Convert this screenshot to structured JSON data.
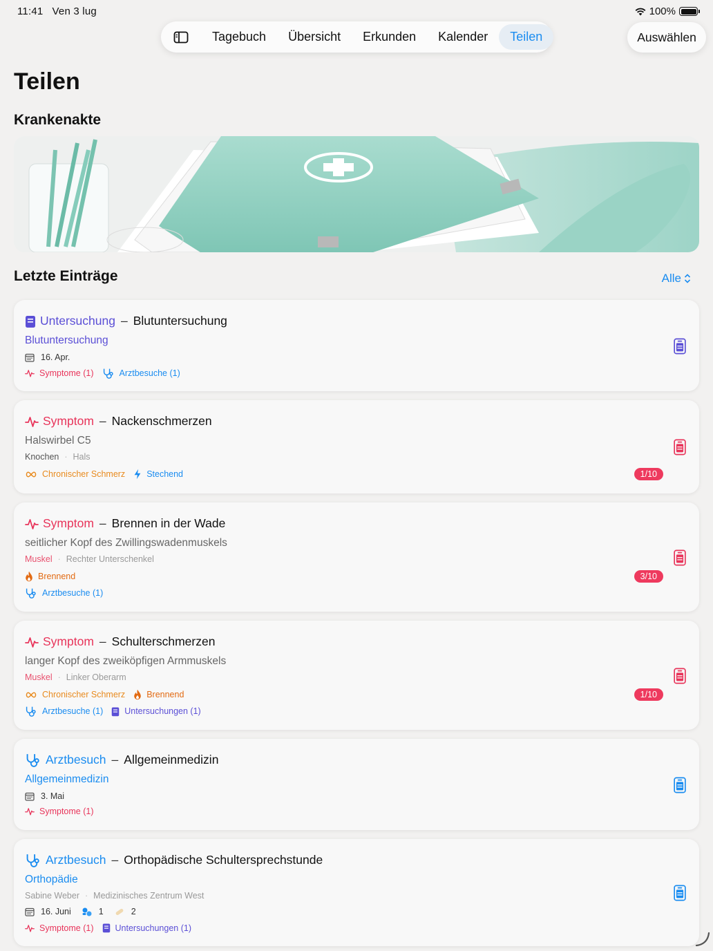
{
  "status": {
    "time": "11:41",
    "date": "Ven 3 lug",
    "battery": "100%"
  },
  "nav": {
    "tabs": [
      {
        "label": "Tagebuch"
      },
      {
        "label": "Übersicht"
      },
      {
        "label": "Erkunden"
      },
      {
        "label": "Kalender"
      },
      {
        "label": "Teilen",
        "active": true
      }
    ],
    "select_label": "Auswählen"
  },
  "page": {
    "title": "Teilen",
    "record_section": "Krankenakte",
    "recent_section": "Letzte Einträge",
    "filter_label": "Alle"
  },
  "colors": {
    "accent": "#1a8cf0",
    "symptom": "#e8345a",
    "exam": "#5b4fd6",
    "badge": "#ee3a5e",
    "chronic": "#e88a1e",
    "burning": "#e26a12"
  },
  "entries": [
    {
      "category": "Untersuchung",
      "title": "Blutuntersuchung",
      "icon": "clipboard-icon",
      "subtitle": "Blutuntersuchung",
      "date": "16. Apr.",
      "chips": [
        {
          "label": "Symptome (1)",
          "icon": "pulse-icon"
        },
        {
          "label": "Arztbesuche (1)",
          "icon": "stethoscope-icon"
        }
      ]
    },
    {
      "category": "Symptom",
      "title": "Nackenschmerzen",
      "icon": "pulse-icon",
      "subtitle": "Halswirbel C5",
      "meta": [
        "Knochen",
        "Hals"
      ],
      "chips": [
        {
          "label": "Chronischer Schmerz",
          "icon": "infinity-icon"
        },
        {
          "label": "Stechend",
          "icon": "bolt-icon"
        }
      ],
      "severity": "1/10"
    },
    {
      "category": "Symptom",
      "title": "Brennen in der Wade",
      "icon": "pulse-icon",
      "subtitle": "seitlicher Kopf des Zwillingswadenmuskels",
      "meta": [
        "Muskel",
        "Rechter Unterschenkel"
      ],
      "chips": [
        {
          "label": "Brennend",
          "icon": "flame-icon"
        }
      ],
      "chips2": [
        {
          "label": "Arztbesuche (1)",
          "icon": "stethoscope-icon"
        }
      ],
      "severity": "3/10"
    },
    {
      "category": "Symptom",
      "title": "Schulterschmerzen",
      "icon": "pulse-icon",
      "subtitle": "langer Kopf des zweiköpfigen Armmuskels",
      "meta": [
        "Muskel",
        "Linker Oberarm"
      ],
      "chips": [
        {
          "label": "Chronischer Schmerz",
          "icon": "infinity-icon"
        },
        {
          "label": "Brennend",
          "icon": "flame-icon"
        }
      ],
      "chips2": [
        {
          "label": "Arztbesuche (1)",
          "icon": "stethoscope-icon"
        },
        {
          "label": "Untersuchungen (1)",
          "icon": "clipboard-icon"
        }
      ],
      "severity": "1/10"
    },
    {
      "category": "Arztbesuch",
      "title": "Allgemeinmedizin",
      "icon": "stethoscope-icon",
      "subtitle": "Allgemeinmedizin",
      "date": "3. Mai",
      "chips": [
        {
          "label": "Symptome (1)",
          "icon": "pulse-icon"
        }
      ]
    },
    {
      "category": "Arztbesuch",
      "title": "Orthopädische Schultersprechstunde",
      "icon": "stethoscope-icon",
      "subtitle": "Orthopädie",
      "meta": [
        "Sabine Weber",
        "Medizinisches Zentrum West"
      ],
      "date": "16. Juni",
      "pills_count": "1",
      "bandage_count": "2",
      "chips": [
        {
          "label": "Symptome (1)",
          "icon": "pulse-icon"
        },
        {
          "label": "Untersuchungen (1)",
          "icon": "clipboard-icon"
        }
      ]
    }
  ]
}
